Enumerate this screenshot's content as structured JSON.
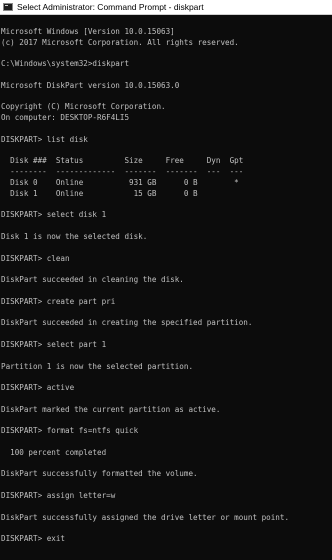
{
  "window": {
    "title": "Select Administrator: Command Prompt - diskpart",
    "colors": {
      "background": "#0c0c0c",
      "text": "#c0c0c0",
      "titlebar": "#ffffff"
    },
    "icon": "cmd-icon"
  },
  "console": {
    "lines": [
      "Microsoft Windows [Version 10.0.15063]",
      "(c) 2017 Microsoft Corporation. All rights reserved.",
      "",
      "C:\\Windows\\system32>diskpart",
      "",
      "Microsoft DiskPart version 10.0.15063.0",
      "",
      "Copyright (C) Microsoft Corporation.",
      "On computer: DESKTOP-R6F4LI5",
      "",
      "DISKPART> list disk",
      "",
      "  Disk ###  Status         Size     Free     Dyn  Gpt",
      "  --------  -------------  -------  -------  ---  ---",
      "  Disk 0    Online          931 GB      0 B        *",
      "  Disk 1    Online           15 GB      0 B",
      "",
      "DISKPART> select disk 1",
      "",
      "Disk 1 is now the selected disk.",
      "",
      "DISKPART> clean",
      "",
      "DiskPart succeeded in cleaning the disk.",
      "",
      "DISKPART> create part pri",
      "",
      "DiskPart succeeded in creating the specified partition.",
      "",
      "DISKPART> select part 1",
      "",
      "Partition 1 is now the selected partition.",
      "",
      "DISKPART> active",
      "",
      "DiskPart marked the current partition as active.",
      "",
      "DISKPART> format fs=ntfs quick",
      "",
      "  100 percent completed",
      "",
      "DiskPart successfully formatted the volume.",
      "",
      "DISKPART> assign letter=w",
      "",
      "DiskPart successfully assigned the drive letter or mount point.",
      "",
      "DISKPART> exit"
    ]
  }
}
